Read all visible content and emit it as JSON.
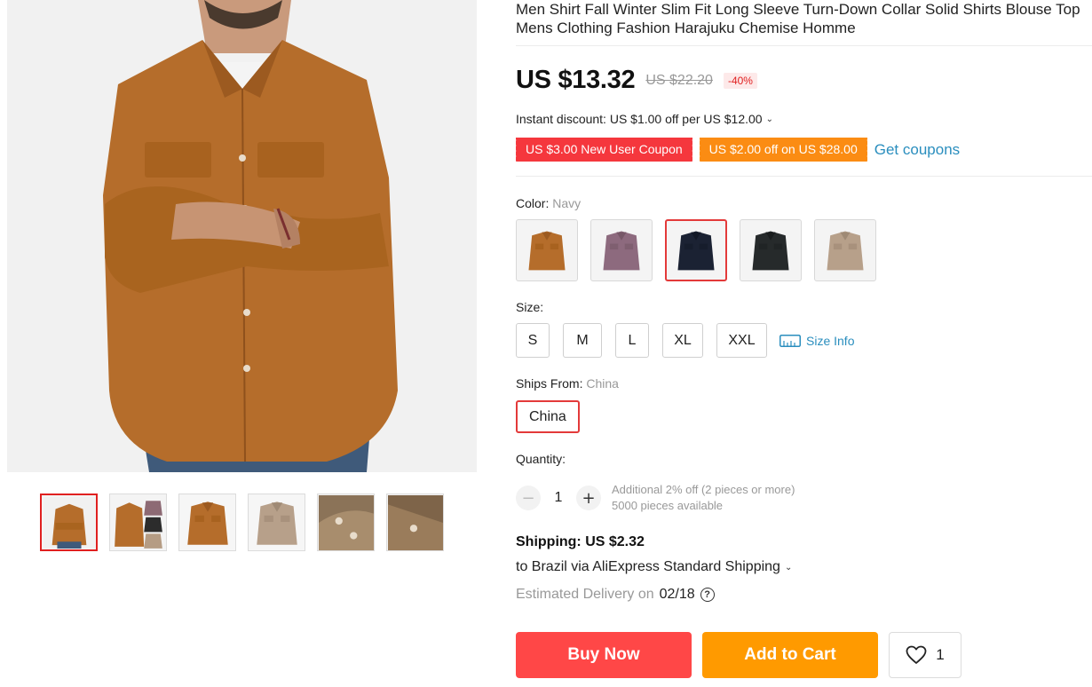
{
  "product": {
    "title_line1": "Men Shirt Fall Winter Slim Fit Long Sleeve Turn-Down Collar Solid Shirts Blouse Top",
    "title_line2": "Mens Clothing Fashion Harajuku Chemise Homme"
  },
  "gallery": {
    "thumbnail_count": 6,
    "active_index": 0
  },
  "pricing": {
    "price": "US $13.32",
    "original_price": "US $22.20",
    "discount": "-40%",
    "instant_discount": "Instant discount: US $1.00 off per US $12.00"
  },
  "coupons": {
    "items": [
      "US $3.00 New User Coupon",
      "US $2.00 off on US $28.00"
    ],
    "get_coupons": "Get coupons",
    "colors": {
      "red": "#f5373d",
      "orange": "#fb8c13"
    }
  },
  "color": {
    "label": "Color:",
    "selected": "Navy",
    "swatches": [
      "brown",
      "purple",
      "navy",
      "black",
      "khaki"
    ],
    "active_index": 2
  },
  "size": {
    "label": "Size:",
    "options": [
      "S",
      "M",
      "L",
      "XL",
      "XXL"
    ],
    "size_info": "Size Info"
  },
  "ships_from": {
    "label": "Ships From:",
    "selected": "China",
    "option": "China"
  },
  "quantity": {
    "label": "Quantity:",
    "value": "1",
    "note_line1": "Additional 2% off (2 pieces or more)",
    "note_line2": "5000 pieces available"
  },
  "shipping": {
    "title": "Shipping: US $2.32",
    "destination": "to Brazil via AliExpress Standard Shipping",
    "estimated_label": "Estimated Delivery on",
    "estimated_date": "02/18"
  },
  "actions": {
    "buy_now": "Buy Now",
    "add_to_cart": "Add to Cart",
    "wishlist_count": "1",
    "colors": {
      "buy": "#ff4747",
      "cart": "#ff9a00"
    }
  }
}
